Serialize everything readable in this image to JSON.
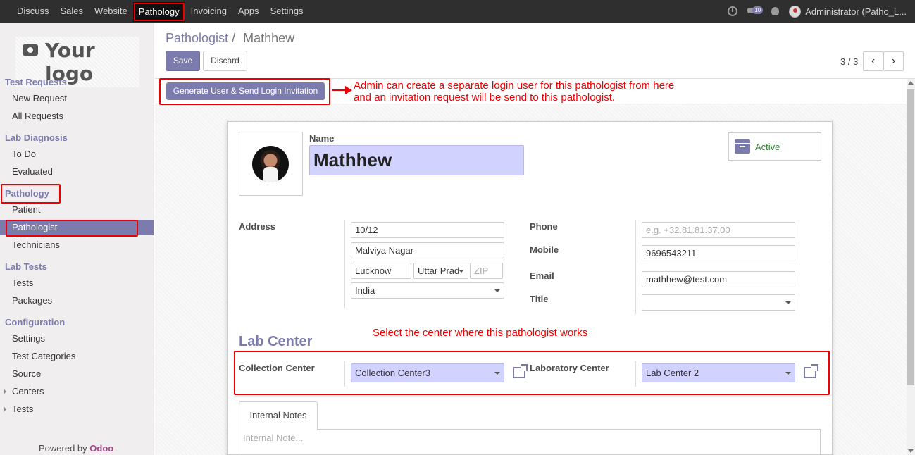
{
  "topbar": {
    "menu": [
      "Discuss",
      "Sales",
      "Website",
      "Pathology",
      "Invoicing",
      "Apps",
      "Settings"
    ],
    "active_menu": "Pathology",
    "messages_count": "10",
    "user": "Administrator (Patho_L..."
  },
  "sidebar": {
    "logo_text": "Your logo",
    "sections": [
      {
        "title": "Test Requests",
        "items": [
          "New Request",
          "All Requests"
        ]
      },
      {
        "title": "Lab Diagnosis",
        "items": [
          "To Do",
          "Evaluated"
        ]
      },
      {
        "title": "Pathology",
        "items": [
          "Patient",
          "Pathologist",
          "Technicians"
        ]
      },
      {
        "title": "Lab Tests",
        "items": [
          "Tests",
          "Packages"
        ]
      },
      {
        "title": "Configuration",
        "items": [
          "Settings",
          "Test Categories",
          "Source",
          "Centers",
          "Tests"
        ]
      }
    ],
    "active_item": "Pathologist",
    "powered_by": "Powered by",
    "powered_brand": "Odoo"
  },
  "control_panel": {
    "breadcrumb_parent": "Pathologist",
    "breadcrumb_sep": "/",
    "breadcrumb_current": "Mathhew",
    "save_label": "Save",
    "discard_label": "Discard",
    "pager": "3 / 3",
    "prev": "‹",
    "next": "›"
  },
  "statusbar": {
    "generate_label": "Generate User & Send Login Invitation"
  },
  "annotations": {
    "note1_line1": "Admin can create a separate login user for this pathologist from here",
    "note1_line2": "and an invitation  request will be send to this pathologist.",
    "note2": "Select the center where this pathologist works"
  },
  "form": {
    "name_label": "Name",
    "name_value": "Mathhew",
    "active_label": "Active",
    "address_label": "Address",
    "street": "10/12",
    "street2": "Malviya Nagar",
    "city": "Lucknow",
    "state": "Uttar Prad",
    "zip_placeholder": "ZIP",
    "country": "India",
    "phone_label": "Phone",
    "phone_placeholder": "e.g. +32.81.81.37.00",
    "mobile_label": "Mobile",
    "mobile_value": "9696543211",
    "email_label": "Email",
    "email_value": "mathhew@test.com",
    "title_label": "Title",
    "title_value": "",
    "lab_center_title": "Lab Center",
    "collection_center_label": "Collection Center",
    "collection_center_value": "Collection Center3",
    "laboratory_center_label": "Laboratory Center",
    "laboratory_center_value": "Lab Center 2",
    "tab_internal_notes": "Internal Notes",
    "internal_note_placeholder": "Internal Note..."
  }
}
